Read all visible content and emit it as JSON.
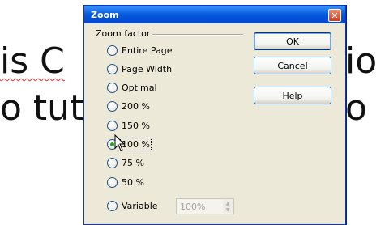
{
  "document": {
    "line1_left": "is C",
    "line1_right": "io",
    "line2_left": "o tut",
    "line2_right": "o"
  },
  "dialog": {
    "title": "Zoom",
    "group_label": "Zoom factor",
    "options": [
      {
        "label": "Entire Page",
        "checked": false
      },
      {
        "label": "Page Width",
        "checked": false
      },
      {
        "label": "Optimal",
        "checked": false
      },
      {
        "label": "200 %",
        "checked": false
      },
      {
        "label": "150 %",
        "checked": false
      },
      {
        "label": "100 %",
        "checked": true
      },
      {
        "label": "75 %",
        "checked": false
      },
      {
        "label": "50 %",
        "checked": false
      },
      {
        "label": "Variable",
        "checked": false
      }
    ],
    "variable_value": "100%",
    "buttons": {
      "ok": "OK",
      "cancel": "Cancel",
      "help": "Help"
    }
  },
  "colors": {
    "titlebar": "#0a5fe0",
    "dialog_bg": "#ece9d8",
    "radio_check": "#21a121"
  }
}
